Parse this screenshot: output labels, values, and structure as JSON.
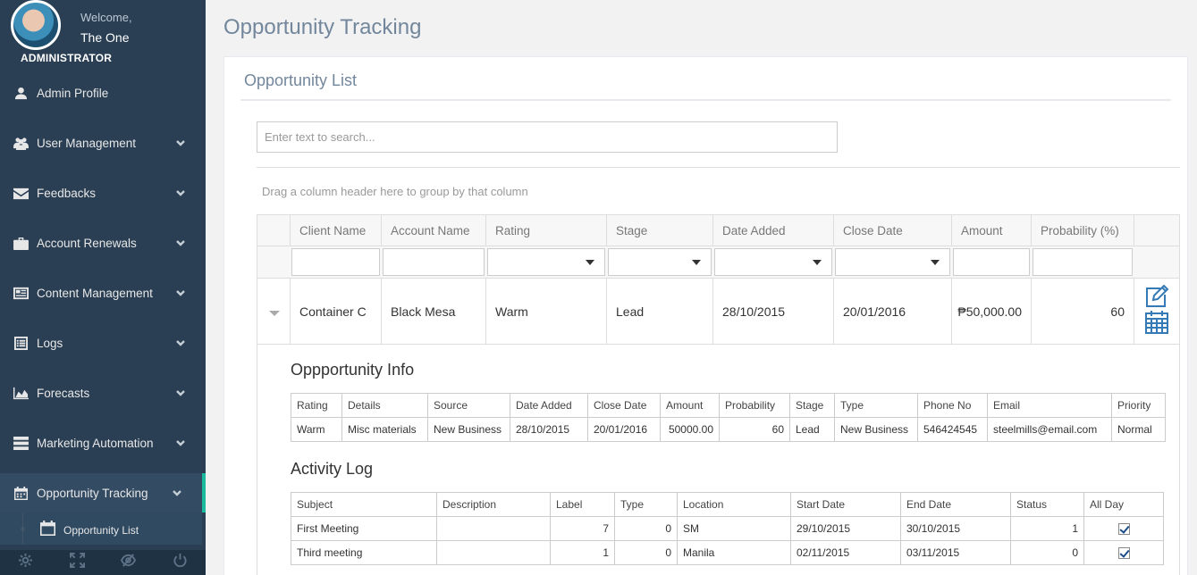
{
  "sidebar": {
    "welcome": "Welcome,",
    "username": "The One",
    "role": "ADMINISTRATOR",
    "items": [
      {
        "label": "Admin Profile",
        "icon": "user-icon",
        "expandable": false
      },
      {
        "label": "User Management",
        "icon": "users-icon",
        "expandable": true
      },
      {
        "label": "Feedbacks",
        "icon": "envelope-icon",
        "expandable": true
      },
      {
        "label": "Account Renewals",
        "icon": "briefcase-icon",
        "expandable": true
      },
      {
        "label": "Content Management",
        "icon": "newspaper-icon",
        "expandable": true
      },
      {
        "label": "Logs",
        "icon": "list-icon",
        "expandable": true
      },
      {
        "label": "Forecasts",
        "icon": "area-chart-icon",
        "expandable": true
      },
      {
        "label": "Marketing Automation",
        "icon": "server-icon",
        "expandable": true
      },
      {
        "label": "Opportunity Tracking",
        "icon": "calendar-icon",
        "expandable": true,
        "active": true
      }
    ],
    "submenu": {
      "label": "Opportunity List",
      "icon": "calendar-icon"
    },
    "footer_icons": [
      "gear-icon",
      "fullscreen-icon",
      "eye-slash-icon",
      "power-icon"
    ],
    "accent_color": "#1abb9c",
    "background": "#2a3f54"
  },
  "page": {
    "title": "Opportunity Tracking",
    "panel_title": "Opportunity List",
    "search_placeholder": "Enter text to search...",
    "group_hint": "Drag a column header here to group by that column"
  },
  "grid": {
    "columns": [
      "Client Name",
      "Account Name",
      "Rating",
      "Stage",
      "Date Added",
      "Close Date",
      "Amount",
      "Probability (%)"
    ],
    "row": {
      "client_name": "Container C",
      "account_name": "Black Mesa",
      "rating": "Warm",
      "stage": "Lead",
      "date_added": "28/10/2015",
      "close_date": "20/01/2016",
      "amount": "₱50,000.00",
      "probability": "60"
    }
  },
  "detail": {
    "info_title": "Oppportunity Info",
    "info_columns": [
      "Rating",
      "Details",
      "Source",
      "Date Added",
      "Close Date",
      "Amount",
      "Probability",
      "Stage",
      "Type",
      "Phone No",
      "Email",
      "Priority"
    ],
    "info_row": [
      "Warm",
      "Misc materials",
      "New Business",
      "28/10/2015",
      "20/01/2016",
      "50000.00",
      "60",
      "Lead",
      "New Business",
      "546424545",
      "steelmills@email.com",
      "Normal"
    ],
    "log_title": "Activity Log",
    "log_columns": [
      "Subject",
      "Description",
      "Label",
      "Type",
      "Location",
      "Start Date",
      "End Date",
      "Status",
      "All Day"
    ],
    "log_rows": [
      {
        "subject": "First Meeting",
        "description": "",
        "label": "7",
        "type": "0",
        "location": "SM",
        "start": "29/10/2015",
        "end": "30/10/2015",
        "status": "1",
        "all_day": true
      },
      {
        "subject": "Third meeting",
        "description": "",
        "label": "1",
        "type": "0",
        "location": "Manila",
        "start": "02/11/2015",
        "end": "03/11/2015",
        "status": "0",
        "all_day": true
      }
    ]
  }
}
